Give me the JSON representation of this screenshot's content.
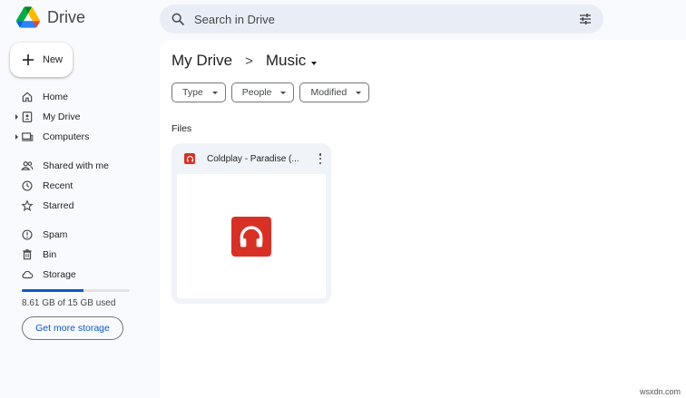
{
  "app": {
    "name": "Drive"
  },
  "search": {
    "placeholder": "Search in Drive"
  },
  "new_button": {
    "label": "New"
  },
  "sidebar": {
    "items": [
      {
        "label": "Home",
        "icon": "home-icon",
        "expandable": false
      },
      {
        "label": "My Drive",
        "icon": "my-drive-icon",
        "expandable": true
      },
      {
        "label": "Computers",
        "icon": "computers-icon",
        "expandable": true
      },
      {
        "label": "Shared with me",
        "icon": "shared-icon",
        "expandable": false
      },
      {
        "label": "Recent",
        "icon": "clock-icon",
        "expandable": false
      },
      {
        "label": "Starred",
        "icon": "star-icon",
        "expandable": false
      },
      {
        "label": "Spam",
        "icon": "spam-icon",
        "expandable": false
      },
      {
        "label": "Bin",
        "icon": "trash-icon",
        "expandable": false
      },
      {
        "label": "Storage",
        "icon": "cloud-icon",
        "expandable": false
      }
    ]
  },
  "storage": {
    "used_text": "8.61 GB of 15 GB used",
    "used_fraction": 0.574,
    "button_label": "Get more storage"
  },
  "breadcrumb": {
    "root": "My Drive",
    "separator": ">",
    "current": "Music"
  },
  "filters": [
    {
      "label": "Type"
    },
    {
      "label": "People"
    },
    {
      "label": "Modified"
    }
  ],
  "files_section": {
    "label": "Files"
  },
  "files": [
    {
      "name": "Coldplay - Paradise (...",
      "icon": "audio-file-icon",
      "color": "#d93025"
    }
  ],
  "watermark": "wsxdn.com",
  "colors": {
    "accent": "#0b57d0",
    "audio": "#d93025",
    "surface": "#f8fafd",
    "search_bg": "#e9eef6"
  }
}
